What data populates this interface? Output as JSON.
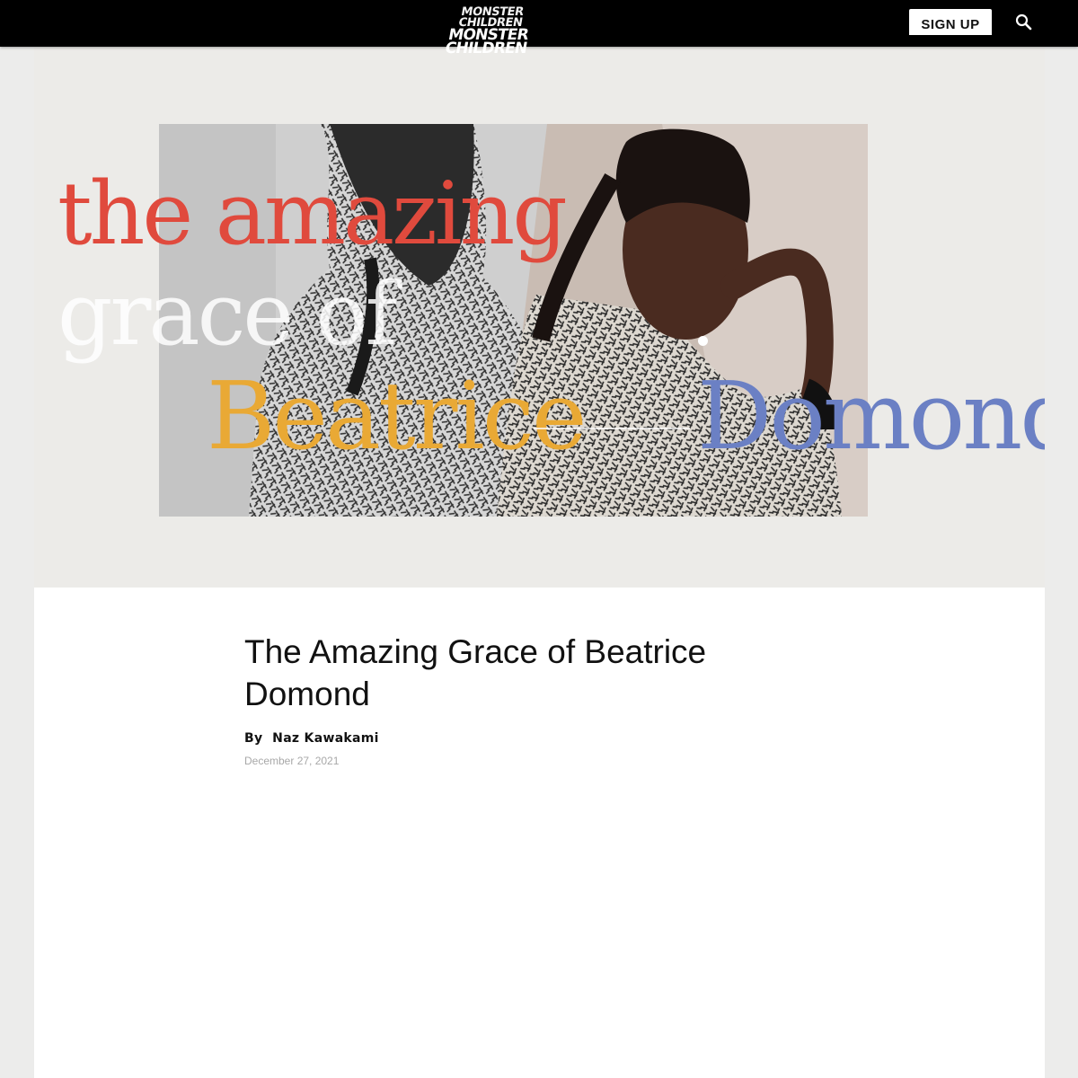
{
  "header": {
    "logo_line1": "MONSTER CHILDREN",
    "logo_line2": "MONSTER CHILDREN",
    "signup_label": "SIGN UP",
    "search_icon": "search-icon"
  },
  "hero": {
    "line1": "the amazing",
    "line2": "grace of",
    "line3a": "Beatrice",
    "line3b": "Domond",
    "colors": {
      "line1": "#e04a3d",
      "line2": "#ffffff",
      "line3a": "#e9a935",
      "line3b": "#6b80c4",
      "background": "#ecebe8"
    }
  },
  "article": {
    "title": "The Amazing Grace of Beatrice Domond",
    "by_label": "By",
    "author": "Naz Kawakami",
    "date": "December 27, 2021"
  }
}
